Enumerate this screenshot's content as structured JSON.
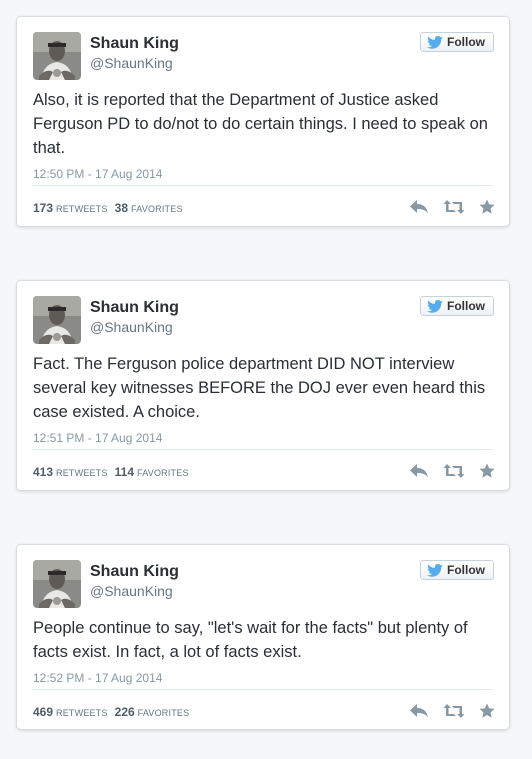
{
  "tweets": [
    {
      "author_name": "Shaun King",
      "author_handle": "@ShaunKing",
      "follow_label": "Follow",
      "text": "Also, it is reported that the Department of Justice asked Ferguson PD to do/not to do certain things. I need to speak on that.",
      "timestamp": "12:50 PM - 17 Aug 2014",
      "retweets": "173",
      "retweets_label": "RETWEETS",
      "favorites": "38",
      "favorites_label": "FAVORITES"
    },
    {
      "author_name": "Shaun King",
      "author_handle": "@ShaunKing",
      "follow_label": "Follow",
      "text": "Fact. The Ferguson police department DID NOT interview several key witnesses BEFORE the DOJ ever even heard this case existed. A choice.",
      "timestamp": "12:51 PM - 17 Aug 2014",
      "retweets": "413",
      "retweets_label": "RETWEETS",
      "favorites": "114",
      "favorites_label": "FAVORITES"
    },
    {
      "author_name": "Shaun King",
      "author_handle": "@ShaunKing",
      "follow_label": "Follow",
      "text": "People continue to say, \"let's wait for the facts\" but plenty of facts exist. In fact, a lot of facts exist.",
      "timestamp": "12:52 PM - 17 Aug 2014",
      "retweets": "469",
      "retweets_label": "RETWEETS",
      "favorites": "226",
      "favorites_label": "FAVORITES"
    }
  ],
  "icons": {
    "follow": "twitter-bird-icon",
    "reply": "reply-icon",
    "retweet": "retweet-icon",
    "favorite": "star-icon"
  },
  "colors": {
    "page_background": "#f5f8fa",
    "card_background": "#ffffff",
    "twitter_blue": "#55acee",
    "text": "#292f33",
    "muted": "#8899a6"
  }
}
